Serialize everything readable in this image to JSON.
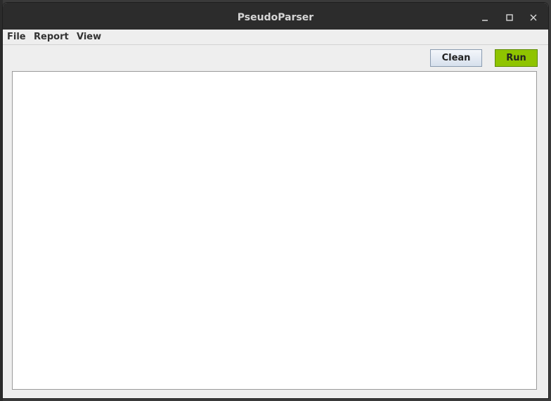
{
  "window": {
    "title": "PseudoParser",
    "controls": {
      "minimize": "minimize-icon",
      "maximize": "maximize-icon",
      "close": "close-icon"
    }
  },
  "menubar": {
    "items": [
      "File",
      "Report",
      "View"
    ]
  },
  "toolbar": {
    "clean_label": "Clean",
    "run_label": "Run"
  },
  "editor": {
    "value": ""
  },
  "colors": {
    "titlebar": "#2c2c2c",
    "run_button": "#8fc400",
    "clean_button": "#dbe4ef",
    "window_bg": "#eeeeee"
  }
}
